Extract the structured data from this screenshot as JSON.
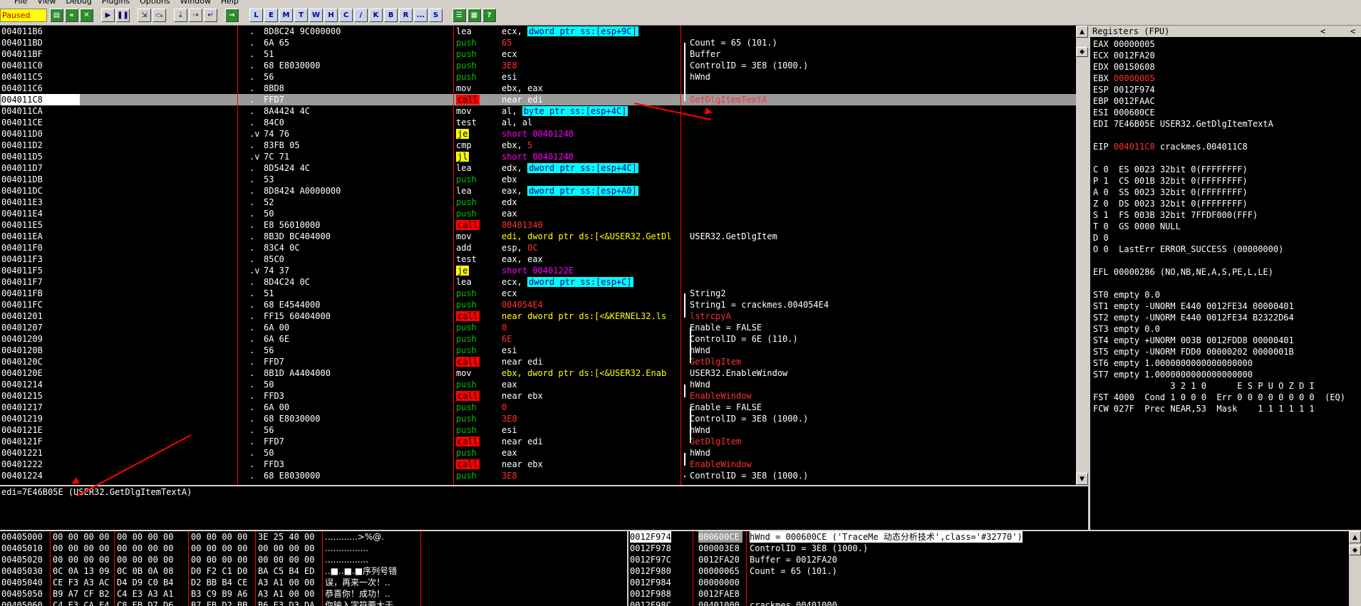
{
  "menu": [
    "File",
    "View",
    "Debug",
    "Plugins",
    "Options",
    "Window",
    "Help"
  ],
  "status": "Paused",
  "toolbar_letters": [
    "L",
    "E",
    "M",
    "T",
    "W",
    "H",
    "C",
    "/",
    "K",
    "B",
    "R",
    "...",
    "S"
  ],
  "disasm": [
    {
      "addr": "004011B6",
      "mark": ".",
      "hex": "8D8C24 9C000000",
      "mn": "lea",
      "mn_style": "w",
      "op_a": "ecx, ",
      "op_b": "dword ptr ss:[esp+9C]",
      "op_b_style": "cyan",
      "comment": ""
    },
    {
      "addr": "004011BD",
      "mark": ".",
      "hex": "6A 65",
      "mn": "push",
      "mn_style": "g",
      "op_a": "65",
      "op_a_style": "r",
      "comment": "Count = 65 (101.)"
    },
    {
      "addr": "004011BF",
      "mark": ".",
      "hex": "51",
      "mn": "push",
      "mn_style": "g",
      "op_a": "ecx",
      "comment": "Buffer"
    },
    {
      "addr": "004011C0",
      "mark": ".",
      "hex": "68 E8030000",
      "mn": "push",
      "mn_style": "g",
      "op_a": "3E8",
      "op_a_style": "r",
      "comment": "ControlID = 3E8 (1000.)"
    },
    {
      "addr": "004011C5",
      "mark": ".",
      "hex": "56",
      "mn": "push",
      "mn_style": "g",
      "op_a": "esi",
      "comment": "hWnd"
    },
    {
      "addr": "004011C6",
      "mark": ".",
      "hex": "8BD8",
      "mn": "mov",
      "mn_style": "w",
      "op_a": "ebx, eax",
      "comment": ""
    },
    {
      "addr": "004011C8",
      "mark": ".",
      "hex": "FFD7",
      "mn": "call",
      "mn_style": "red",
      "op_a": "near edi",
      "comment": "GetDlgItemTextA",
      "comment_style": "r",
      "selected": true
    },
    {
      "addr": "004011CA",
      "mark": ".",
      "hex": "8A4424 4C",
      "mn": "mov",
      "mn_style": "w",
      "op_a": "al, ",
      "op_b": "byte ptr ss:[esp+4C]",
      "op_b_style": "cyan",
      "comment": ""
    },
    {
      "addr": "004011CE",
      "mark": ".",
      "hex": "84C0",
      "mn": "test",
      "mn_style": "w",
      "op_a": "al, al",
      "comment": ""
    },
    {
      "addr": "004011D0",
      "mark": ".v",
      "hex": "74 76",
      "mn": "je",
      "mn_style": "yel",
      "op_a": "short 00401248",
      "op_a_style": "m",
      "comment": ""
    },
    {
      "addr": "004011D2",
      "mark": ".",
      "hex": "83FB 05",
      "mn": "cmp",
      "mn_style": "w",
      "op_a": "ebx, ",
      "op_b": "5",
      "op_b_style": "r",
      "comment": ""
    },
    {
      "addr": "004011D5",
      "mark": ".v",
      "hex": "7C 71",
      "mn": "jl",
      "mn_style": "yel",
      "op_a": "short 00401248",
      "op_a_style": "m",
      "comment": ""
    },
    {
      "addr": "004011D7",
      "mark": ".",
      "hex": "8D5424 4C",
      "mn": "lea",
      "mn_style": "w",
      "op_a": "edx, ",
      "op_b": "dword ptr ss:[esp+4C]",
      "op_b_style": "cyan",
      "comment": ""
    },
    {
      "addr": "004011DB",
      "mark": ".",
      "hex": "53",
      "mn": "push",
      "mn_style": "g",
      "op_a": "ebx",
      "comment": ""
    },
    {
      "addr": "004011DC",
      "mark": ".",
      "hex": "8D8424 A0000000",
      "mn": "lea",
      "mn_style": "w",
      "op_a": "eax, ",
      "op_b": "dword ptr ss:[esp+A0]",
      "op_b_style": "cyan",
      "comment": ""
    },
    {
      "addr": "004011E3",
      "mark": ".",
      "hex": "52",
      "mn": "push",
      "mn_style": "g",
      "op_a": "edx",
      "comment": ""
    },
    {
      "addr": "004011E4",
      "mark": ".",
      "hex": "50",
      "mn": "push",
      "mn_style": "g",
      "op_a": "eax",
      "comment": ""
    },
    {
      "addr": "004011E5",
      "mark": ".",
      "hex": "E8 56010000",
      "mn": "call",
      "mn_style": "red",
      "op_a": "00401340",
      "op_a_style": "r",
      "comment": ""
    },
    {
      "addr": "004011EA",
      "mark": ".",
      "hex": "8B3D BC404000",
      "mn": "mov",
      "mn_style": "w",
      "op_a": "edi, dword ptr ds:[<&USER32.GetDl",
      "op_a_style": "y",
      "comment": "USER32.GetDlgItem"
    },
    {
      "addr": "004011F0",
      "mark": ".",
      "hex": "83C4 0C",
      "mn": "add",
      "mn_style": "w",
      "op_a": "esp, ",
      "op_b": "0C",
      "op_b_style": "r",
      "comment": ""
    },
    {
      "addr": "004011F3",
      "mark": ".",
      "hex": "85C0",
      "mn": "test",
      "mn_style": "w",
      "op_a": "eax, eax",
      "comment": ""
    },
    {
      "addr": "004011F5",
      "mark": ".v",
      "hex": "74 37",
      "mn": "je",
      "mn_style": "yel",
      "op_a": "short 0040122E",
      "op_a_style": "m",
      "comment": ""
    },
    {
      "addr": "004011F7",
      "mark": ".",
      "hex": "8D4C24 0C",
      "mn": "lea",
      "mn_style": "w",
      "op_a": "ecx, ",
      "op_b": "dword ptr ss:[esp+C]",
      "op_b_style": "cyan",
      "comment": ""
    },
    {
      "addr": "004011FB",
      "mark": ".",
      "hex": "51",
      "mn": "push",
      "mn_style": "g",
      "op_a": "ecx",
      "comment": "String2"
    },
    {
      "addr": "004011FC",
      "mark": ".",
      "hex": "68 E4544000",
      "mn": "push",
      "mn_style": "g",
      "op_a": "004054E4",
      "op_a_style": "r",
      "comment": "String1 = crackmes.004054E4"
    },
    {
      "addr": "00401201",
      "mark": ".",
      "hex": "FF15 60404000",
      "mn": "call",
      "mn_style": "red",
      "op_a": "near dword ptr ds:[<&KERNEL32.ls",
      "op_a_style": "y",
      "comment": "lstrcpyA",
      "comment_style": "r"
    },
    {
      "addr": "00401207",
      "mark": ".",
      "hex": "6A 00",
      "mn": "push",
      "mn_style": "g",
      "op_a": "0",
      "op_a_style": "r",
      "comment": "Enable = FALSE"
    },
    {
      "addr": "00401209",
      "mark": ".",
      "hex": "6A 6E",
      "mn": "push",
      "mn_style": "g",
      "op_a": "6E",
      "op_a_style": "r",
      "comment": "ControlID = 6E (110.)"
    },
    {
      "addr": "0040120B",
      "mark": ".",
      "hex": "56",
      "mn": "push",
      "mn_style": "g",
      "op_a": "esi",
      "comment": "hWnd"
    },
    {
      "addr": "0040120C",
      "mark": ".",
      "hex": "FFD7",
      "mn": "call",
      "mn_style": "red",
      "op_a": "near edi",
      "comment": "GetDlgItem",
      "comment_style": "r"
    },
    {
      "addr": "0040120E",
      "mark": ".",
      "hex": "8B1D A4404000",
      "mn": "mov",
      "mn_style": "w",
      "op_a": "ebx, dword ptr ds:[<&USER32.Enab",
      "op_a_style": "y",
      "comment": "USER32.EnableWindow"
    },
    {
      "addr": "00401214",
      "mark": ".",
      "hex": "50",
      "mn": "push",
      "mn_style": "g",
      "op_a": "eax",
      "comment": "hWnd"
    },
    {
      "addr": "00401215",
      "mark": ".",
      "hex": "FFD3",
      "mn": "call",
      "mn_style": "red",
      "op_a": "near ebx",
      "comment": "EnableWindow",
      "comment_style": "r"
    },
    {
      "addr": "00401217",
      "mark": ".",
      "hex": "6A 00",
      "mn": "push",
      "mn_style": "g",
      "op_a": "0",
      "op_a_style": "r",
      "comment": "Enable = FALSE"
    },
    {
      "addr": "00401219",
      "mark": ".",
      "hex": "68 E8030000",
      "mn": "push",
      "mn_style": "g",
      "op_a": "3E8",
      "op_a_style": "r",
      "comment": "ControlID = 3E8 (1000.)"
    },
    {
      "addr": "0040121E",
      "mark": ".",
      "hex": "56",
      "mn": "push",
      "mn_style": "g",
      "op_a": "esi",
      "comment": "hWnd"
    },
    {
      "addr": "0040121F",
      "mark": ".",
      "hex": "FFD7",
      "mn": "call",
      "mn_style": "red",
      "op_a": "near edi",
      "comment": "GetDlgItem",
      "comment_style": "r"
    },
    {
      "addr": "00401221",
      "mark": ".",
      "hex": "50",
      "mn": "push",
      "mn_style": "g",
      "op_a": "eax",
      "comment": "hWnd"
    },
    {
      "addr": "00401222",
      "mark": ".",
      "hex": "FFD3",
      "mn": "call",
      "mn_style": "red",
      "op_a": "near ebx",
      "comment": "EnableWindow",
      "comment_style": "r"
    },
    {
      "addr": "00401224",
      "mark": ".",
      "hex": "68 E8030000",
      "mn": "push",
      "mn_style": "g",
      "op_a": "3E8",
      "op_a_style": "r",
      "comment": "ControlID = 3E8 (1000.)"
    }
  ],
  "info_line": "edi=7E46B05E (USER32.GetDlgItemTextA)",
  "registers": {
    "title": "Registers (FPU)",
    "nav_left": "<",
    "nav_right": "<",
    "lines": [
      {
        "t": "EAX 00000005"
      },
      {
        "t": "ECX 0012FA20"
      },
      {
        "t": "EDX 00150608"
      },
      {
        "t": "EBX ",
        "hl": "00000005"
      },
      {
        "t": "ESP 0012F974"
      },
      {
        "t": "EBP 0012FAAC"
      },
      {
        "t": "ESI 000600CE"
      },
      {
        "t": "EDI 7E46B05E USER32.GetDlgItemTextA"
      },
      {
        "t": ""
      },
      {
        "t": "EIP ",
        "hl": "004011C8",
        "rest": " crackmes.004011C8"
      },
      {
        "t": ""
      },
      {
        "t": "C 0  ES 0023 32bit 0(FFFFFFFF)"
      },
      {
        "t": "P 1  CS 001B 32bit 0(FFFFFFFF)"
      },
      {
        "t": "A 0  SS 0023 32bit 0(FFFFFFFF)"
      },
      {
        "t": "Z 0  DS 0023 32bit 0(FFFFFFFF)"
      },
      {
        "t": "S 1  FS 003B 32bit 7FFDF000(FFF)"
      },
      {
        "t": "T 0  GS 0000 NULL"
      },
      {
        "t": "D 0"
      },
      {
        "t": "O 0  LastErr ERROR_SUCCESS (00000000)"
      },
      {
        "t": ""
      },
      {
        "t": "EFL 00000286 (NO,NB,NE,A,S,PE,L,LE)"
      },
      {
        "t": ""
      },
      {
        "t": "ST0 empty 0.0"
      },
      {
        "t": "ST1 empty -UNORM E440 0012FE34 00000401"
      },
      {
        "t": "ST2 empty -UNORM E440 0012FE34 B2322D64"
      },
      {
        "t": "ST3 empty 0.0"
      },
      {
        "t": "ST4 empty +UNORM 003B 0012FDD8 00000401"
      },
      {
        "t": "ST5 empty -UNORM FDD0 00000202 0000001B"
      },
      {
        "t": "ST6 empty 1.0000000000000000000"
      },
      {
        "t": "ST7 empty 1.0000000000000000000"
      },
      {
        "t": "               3 2 1 0      E S P U O Z D I"
      },
      {
        "t": "FST 4000  Cond 1 0 0 0  Err 0 0 0 0 0 0 0 0  (EQ)"
      },
      {
        "t": "FCW 027F  Prec NEAR,53  Mask    1 1 1 1 1 1"
      }
    ]
  },
  "dump": [
    {
      "addr": "00405000",
      "b1": "00 00 00 00",
      "b2": "00 00 00 00",
      "b3": "00 00 00 00",
      "b4": "3E 25 40 00",
      "ascii": "............>%@."
    },
    {
      "addr": "00405010",
      "b1": "00 00 00 00",
      "b2": "00 00 00 00",
      "b3": "00 00 00 00",
      "b4": "00 00 00 00",
      "ascii": "................"
    },
    {
      "addr": "00405020",
      "b1": "00 00 00 00",
      "b2": "00 00 00 00",
      "b3": "00 00 00 00",
      "b4": "00 00 00 00",
      "ascii": "................"
    },
    {
      "addr": "00405030",
      "b1": "0C 0A 13 09",
      "b2": "0C 0B 0A 08",
      "b3": "D0 F2 C1 D0",
      "b4": "BA C5 B4 ED",
      "ascii": "..■..■.■序列号错"
    },
    {
      "addr": "00405040",
      "b1": "CE F3 A3 AC",
      "b2": "D4 D9 C0 B4",
      "b3": "D2 BB B4 CE",
      "b4": "A3 A1 00 00",
      "ascii": "误，再来一次！.."
    },
    {
      "addr": "00405050",
      "b1": "B9 A7 CF B2",
      "b2": "C4 E3 A3 A1",
      "b3": "B3 C9 B9 A6",
      "b4": "A3 A1 00 00",
      "ascii": "恭喜你！成功！.."
    },
    {
      "addr": "00405060",
      "b1": "C4 E3 CA E4",
      "b2": "C8 EB D7 D6",
      "b3": "B7 FB D2 BB",
      "b4": "B6 E3 D3 DA",
      "ascii": "你输入字符要大于"
    }
  ],
  "stack": [
    {
      "addr": "0012F974",
      "val": "000600CE",
      "comment": "hWnd = 000600CE ('TraceMe 动态分析技术',class='#32770')",
      "selected": true
    },
    {
      "addr": "0012F978",
      "val": "000003E8",
      "comment": "ControlID = 3E8 (1000.)"
    },
    {
      "addr": "0012F97C",
      "val": "0012FA20",
      "comment": "Buffer = 0012FA20"
    },
    {
      "addr": "0012F980",
      "val": "00000065",
      "comment": "Count = 65 (101.)"
    },
    {
      "addr": "0012F984",
      "val": "00000000",
      "comment": ""
    },
    {
      "addr": "0012F988",
      "val": "0012FAE8",
      "comment": ""
    },
    {
      "addr": "0012F98C",
      "val": "00401000",
      "comment": "crackmes.00401000"
    }
  ]
}
